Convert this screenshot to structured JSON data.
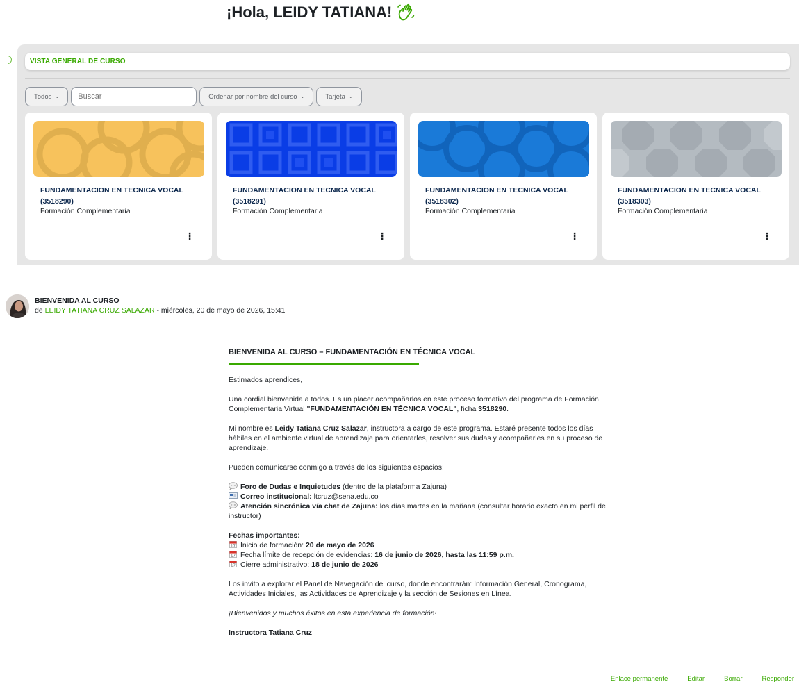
{
  "greeting": {
    "text": "¡Hola, LEIDY TATIANA!",
    "icon": "waving-hand-icon"
  },
  "overview": {
    "title": "VISTA GENERAL DE CURSO",
    "filters": {
      "grouping": "Todos",
      "search_placeholder": "Buscar",
      "sort": "Ordenar por nombre del curso",
      "view": "Tarjeta"
    },
    "courses": [
      {
        "name": "FUNDAMENTACION EN TECNICA VOCAL (3518290)",
        "category": "Formación Complementaria",
        "pattern": "circles",
        "color": "#f7c25c"
      },
      {
        "name": "FUNDAMENTACION EN TECNICA VOCAL (3518291)",
        "category": "Formación Complementaria",
        "pattern": "squares",
        "color": "#0a3de6"
      },
      {
        "name": "FUNDAMENTACION EN TECNICA VOCAL (3518302)",
        "category": "Formación Complementaria",
        "pattern": "circles",
        "color": "#1a7ad8"
      },
      {
        "name": "FUNDAMENTACION EN TECNICA VOCAL (3518303)",
        "category": "Formación Complementaria",
        "pattern": "octagons",
        "color": "#b4bbc1"
      }
    ]
  },
  "post": {
    "subject": "BIENVENIDA AL CURSO",
    "by_prefix": "de ",
    "author": "LEIDY TATIANA CRUZ SALAZAR",
    "date": " - miércoles, 20 de mayo de 2026, 15:41",
    "message": {
      "heading": "BIENVENIDA AL CURSO – FUNDAMENTACIÓN EN TÉCNICA VOCAL",
      "salutation": "Estimados aprendices,",
      "p1_a": "Una cordial bienvenida a todos. Es un placer acompañarlos en este proceso formativo del programa de Formación Complementaria Virtual ",
      "p1_b": "\"FUNDAMENTACIÓN EN TÉCNICA VOCAL\"",
      "p1_c": ", ficha ",
      "p1_d": "3518290",
      "p1_e": ".",
      "p2_a": "Mi nombre es ",
      "p2_b": "Leidy Tatiana Cruz Salazar",
      "p2_c": ", instructora a cargo de este programa. Estaré presente todos los días hábiles en el ambiente virtual de aprendizaje para orientarles, resolver sus dudas y acompañarles en su proceso de aprendizaje.",
      "p3": "Pueden comunicarse conmigo a través de los siguientes espacios:",
      "c1_a": "Foro de Dudas e Inquietudes",
      "c1_b": " (dentro de la plataforma Zajuna)",
      "c2_a": "Correo institucional:",
      "c2_b": " ltcruz@sena.edu.co",
      "c3_a": "Atención sincrónica vía chat de Zajuna:",
      "c3_b": " los días martes en la mañana (consultar horario exacto en mi perfil de instructor)",
      "dates_title": "Fechas importantes:",
      "d1_a": "Inicio de formación: ",
      "d1_b": "20 de mayo de 2026",
      "d2_a": "Fecha límite de recepción de evidencias: ",
      "d2_b": "16 de junio de 2026, hasta las 11:59 p.m.",
      "d3_a": "Cierre administrativo: ",
      "d3_b": "18 de junio de 2026",
      "p4": "Los invito a explorar el Panel de Navegación del curso, donde encontrarán: Información General, Cronograma, Actividades Iniciales, las Actividades de Aprendizaje y la sección de Sesiones en Línea.",
      "p5": "¡Bienvenidos y muchos éxitos en esta experiencia de formación!",
      "signature": "Instructora Tatiana Cruz"
    },
    "actions": [
      "Enlace permanente",
      "Editar",
      "Borrar",
      "Responder"
    ]
  },
  "colors": {
    "accent": "#39a900",
    "course_title": "#0f2a4f"
  }
}
